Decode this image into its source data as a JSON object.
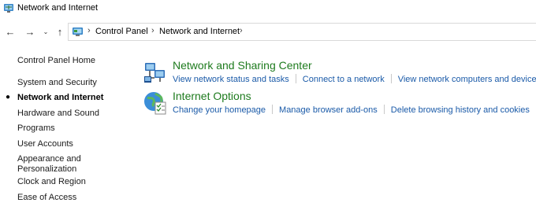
{
  "window": {
    "title": "Network and Internet",
    "app_icon": "network-folder-icon"
  },
  "nav": {
    "back_icon": "back-arrow-icon",
    "forward_icon": "forward-arrow-icon",
    "recent_icon": "chevron-down-icon",
    "up_icon": "up-arrow-icon"
  },
  "address": {
    "location_icon": "control-panel-icon",
    "breadcrumbs": [
      "Control Panel",
      "Network and Internet"
    ]
  },
  "sidebar": {
    "home": "Control Panel Home",
    "items": [
      {
        "label": "System and Security",
        "selected": false
      },
      {
        "label": "Network and Internet",
        "selected": true
      },
      {
        "label": "Hardware and Sound",
        "selected": false
      },
      {
        "label": "Programs",
        "selected": false
      },
      {
        "label": "User Accounts",
        "selected": false
      },
      {
        "label": "Appearance and",
        "label2": "Personalization",
        "selected": false
      },
      {
        "label": "Clock and Region",
        "selected": false
      },
      {
        "label": "Ease of Access",
        "selected": false
      }
    ]
  },
  "sections": [
    {
      "icon": "network-sharing-icon",
      "title": "Network and Sharing Center",
      "links": [
        "View network status and tasks",
        "Connect to a network",
        "View network computers and devices"
      ]
    },
    {
      "icon": "internet-options-icon",
      "title": "Internet Options",
      "links": [
        "Change your homepage",
        "Manage browser add-ons",
        "Delete browsing history and cookies"
      ]
    }
  ],
  "colors": {
    "link": "#1a5aa8",
    "section_title": "#1e7b1e"
  }
}
